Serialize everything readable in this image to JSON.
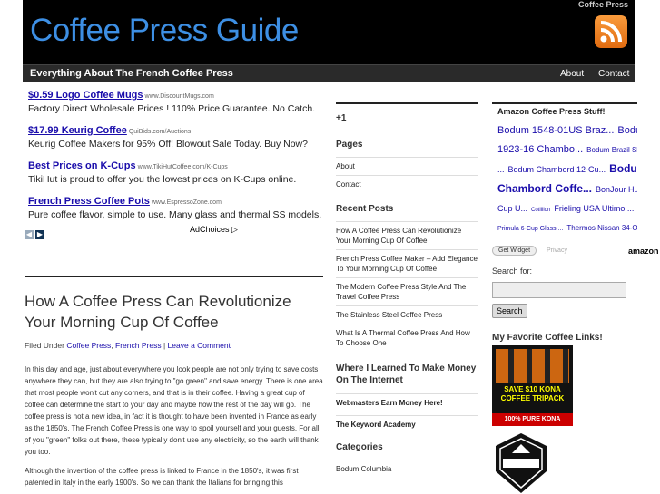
{
  "header": {
    "top_tag": "Coffee Press",
    "site_title": "Coffee Press Guide",
    "rss_icon": "rss-feed-icon"
  },
  "nav": {
    "description": "Everything About The French Coffee Press",
    "links": [
      "About",
      "Contact"
    ]
  },
  "ads": [
    {
      "title": "$0.59 Logo Coffee Mugs",
      "url": "www.DiscountMugs.com",
      "body": "Factory Direct Wholesale Prices ! 110% Price Guarantee. No Catch."
    },
    {
      "title": "$17.99 Keurig Coffee",
      "url": "QuiBids.com/Auctions",
      "body": "Keurig Coffee Makers for 95% Off! Blowout Sale Today. Buy Now?"
    },
    {
      "title": "Best Prices on K-Cups",
      "url": "www.TikiHutCoffee.com/K-Cups",
      "body": "TikiHut is proud to offer you the lowest prices on K-Cups online."
    },
    {
      "title": "French Press Coffee Pots",
      "url": "www.EspressoZone.com",
      "body": "Pure coffee flavor, simple to use. Many glass and thermal SS models."
    }
  ],
  "adchoices": "AdChoices",
  "post": {
    "title": "How A Coffee Press Can Revolutionize Your Morning Cup Of Coffee",
    "filed_under": "Filed Under",
    "cat1": "Coffee Press",
    "cat2": "French Press",
    "separator": "|",
    "comment_link": "Leave a Comment",
    "paragraphs": [
      "In this day and age, just about everywhere you look people are not only trying to save costs anywhere they can, but they are also trying to \"go green\" and save energy. There is one area that most people won't cut any corners, and that is in their coffee. Having a great cup of coffee can determine the start to your day and maybe how the rest of the day will go. The coffee press is not a new idea, in fact it is thought to have been invented in France as early as the 1850's. The French Coffee Press is one way to spoil yourself and your guests. For all of you \"green\" folks out there, these typically don't use any electricity, so the earth will thank you too.",
      "Although the invention of the coffee press is linked to France in the 1850's, it was first patented in Italy in the early 1900's. So we can thank the Italians for bringing this"
    ]
  },
  "col2": {
    "plusone": "+1",
    "pages_heading": "Pages",
    "pages": [
      "About",
      "Contact"
    ],
    "recent_heading": "Recent Posts",
    "recent": [
      "How A Coffee Press Can Revolutionize Your Morning Cup Of Coffee",
      "French Press Coffee Maker – Add Elegance To Your Morning Cup Of Coffee",
      "The Modern Coffee Press Style And The Travel Coffee Press",
      "The Stainless Steel Coffee Press",
      "What Is A Thermal Coffee Press And How To Choose One"
    ],
    "money_heading": "Where I Learned To Make Money On The Internet",
    "money_links": [
      "Webmasters Earn Money Here!",
      "The Keyword Academy"
    ],
    "categories_heading": "Categories",
    "categories": [
      "Bodum Columbia"
    ]
  },
  "col3": {
    "amazon_title": "Amazon Coffee Press Stuff!",
    "tags": [
      [
        "Bodum 1548-01US Braz...",
        "Bodum"
      ],
      [
        "1923-16 Chambo...",
        "Bodum Brazil Shatt"
      ],
      [
        "...",
        "Bodum Chambord 12-Cu...",
        "Bodu"
      ],
      [
        "Chambord Coffe...",
        "BonJour Hugo"
      ],
      [
        "Cup U...",
        "Cotillion",
        "Frieling USA Ultimo ..."
      ],
      [
        "Primula 6-Cup Glass ...",
        "Thermos Nissan 34-O"
      ]
    ],
    "get_widget": "Get Widget",
    "privacy": "Privacy",
    "amazon_logo": "amazon",
    "search_label": "Search for:",
    "search_button": "Search",
    "fav_heading": "My Favorite Coffee Links!",
    "kona_text": "SAVE $10 KONA COFFEE TRIPACK",
    "kona_bottom": "100% PURE KONA"
  }
}
